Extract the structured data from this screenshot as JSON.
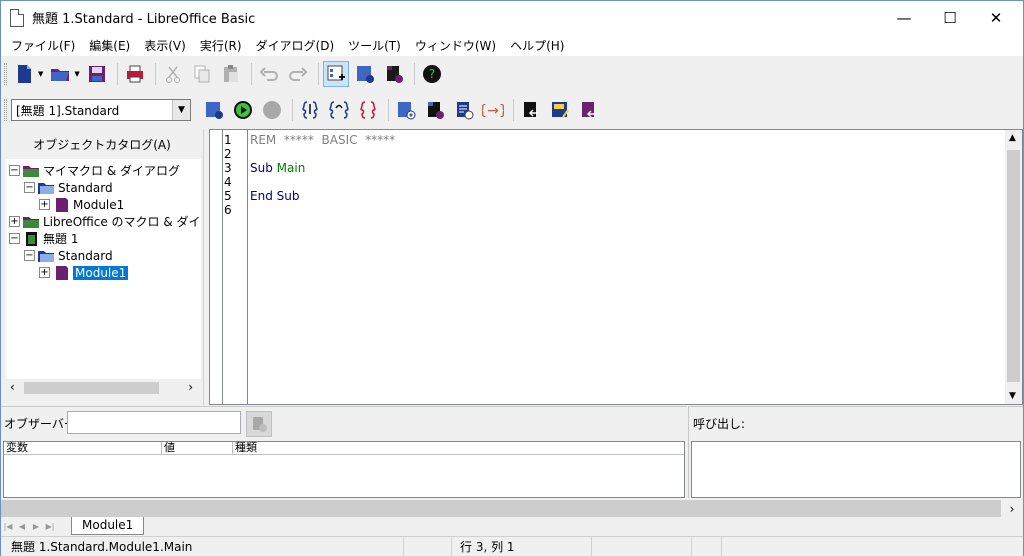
{
  "window": {
    "title": "無題 1.Standard - LibreOffice Basic",
    "minimize": "—",
    "maximize": "☐",
    "close": "✕"
  },
  "menu": [
    "ファイル(F)",
    "編集(E)",
    "表示(V)",
    "実行(R)",
    "ダイアログ(D)",
    "ツール(T)",
    "ウィンドウ(W)",
    "ヘルプ(H)"
  ],
  "library_select": {
    "value": "[無題 1].Standard"
  },
  "catalog": {
    "title": "オブジェクトカタログ(A)",
    "nodes": [
      "マイマクロ & ダイアログ",
      "Standard",
      "Module1",
      "LibreOffice のマクロ & ダイアロ",
      "無題 1",
      "Standard",
      "Module1"
    ]
  },
  "editor": {
    "line_numbers": [
      "1",
      "2",
      "3",
      "4",
      "5",
      "6"
    ],
    "code": {
      "rem": "REM  *****  BASIC  *****",
      "sub_kw": "Sub",
      "sub_name": "Main",
      "end_sub": "End Sub"
    },
    "colors": {
      "comment": "#808080",
      "keyword": "#000080",
      "identifier": "#008000"
    }
  },
  "watch": {
    "label": "オブザーバー:",
    "columns": [
      "変数",
      "値",
      "種類"
    ]
  },
  "call_stack": {
    "label": "呼び出し:"
  },
  "tabs": [
    "Module1"
  ],
  "status": {
    "location": "無題 1.Standard.Module1.Main",
    "position": "行 3, 列 1"
  }
}
